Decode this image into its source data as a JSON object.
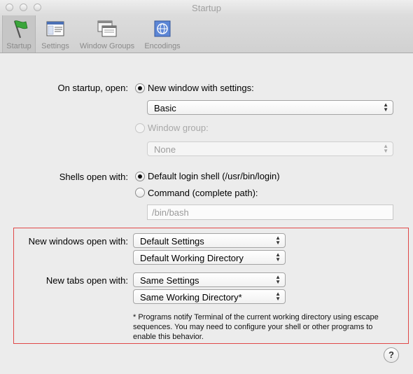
{
  "window": {
    "title": "Startup"
  },
  "toolbar": {
    "items": [
      {
        "label": "Startup",
        "icon": "green-flag-icon",
        "selected": true
      },
      {
        "label": "Settings",
        "icon": "settings-icon",
        "selected": false
      },
      {
        "label": "Window Groups",
        "icon": "window-groups-icon",
        "selected": false
      },
      {
        "label": "Encodings",
        "icon": "globe-encodings-icon",
        "selected": false
      }
    ]
  },
  "startup": {
    "label": "On startup, open:",
    "new_window_option": "New window with settings:",
    "new_window_value": "Basic",
    "window_group_option": "Window group:",
    "window_group_value": "None"
  },
  "shells": {
    "label": "Shells open with:",
    "default_option": "Default login shell (/usr/bin/login)",
    "command_option": "Command (complete path):",
    "command_placeholder": "/bin/bash"
  },
  "new_windows": {
    "label": "New windows open with:",
    "settings_value": "Default Settings",
    "directory_value": "Default Working Directory"
  },
  "new_tabs": {
    "label": "New tabs open with:",
    "settings_value": "Same Settings",
    "directory_value": "Same Working Directory*"
  },
  "footnote": "* Programs notify Terminal of the current working directory using escape sequences. You may need to configure your shell or other programs to enable this behavior.",
  "help": "?",
  "colors": {
    "highlight_border": "#e04848",
    "toolbar_selected": "#c6c6c6"
  }
}
